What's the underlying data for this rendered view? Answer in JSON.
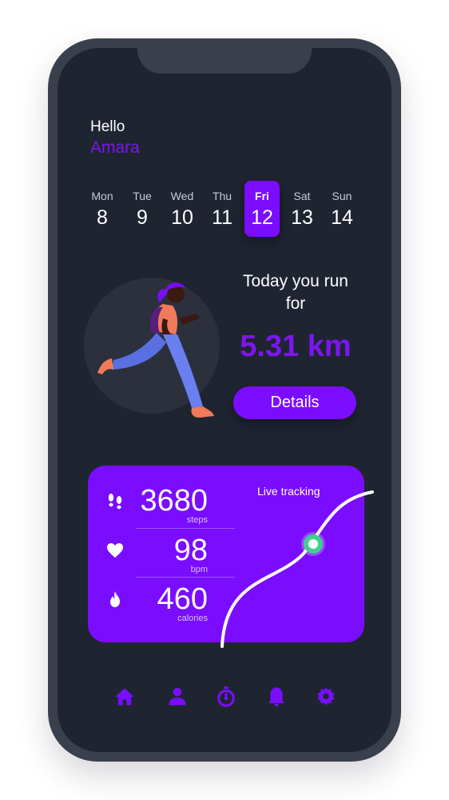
{
  "greeting": "Hello",
  "user_name": "Amara",
  "days": [
    {
      "name": "Mon",
      "date": "8"
    },
    {
      "name": "Tue",
      "date": "9"
    },
    {
      "name": "Wed",
      "date": "10"
    },
    {
      "name": "Thu",
      "date": "11"
    },
    {
      "name": "Fri",
      "date": "12"
    },
    {
      "name": "Sat",
      "date": "13"
    },
    {
      "name": "Sun",
      "date": "14"
    }
  ],
  "selected_day": "Fri",
  "run": {
    "label": "Today you run for",
    "distance": "5.31 km",
    "details_button": "Details"
  },
  "stats": {
    "steps": {
      "value": "3680",
      "unit": "steps",
      "icon": "footprints-icon"
    },
    "bpm": {
      "value": "98",
      "unit": "bpm",
      "icon": "heart-icon"
    },
    "calories": {
      "value": "460",
      "unit": "calories",
      "icon": "flame-icon"
    }
  },
  "live_tracking_label": "Live tracking",
  "nav": [
    "home-icon",
    "profile-icon",
    "stopwatch-icon",
    "bell-icon",
    "gear-icon"
  ],
  "colors": {
    "accent": "#7a0dff",
    "background": "#1f2431",
    "frame": "#3a3f4c",
    "tracker_dot": "#3fcf8e"
  }
}
